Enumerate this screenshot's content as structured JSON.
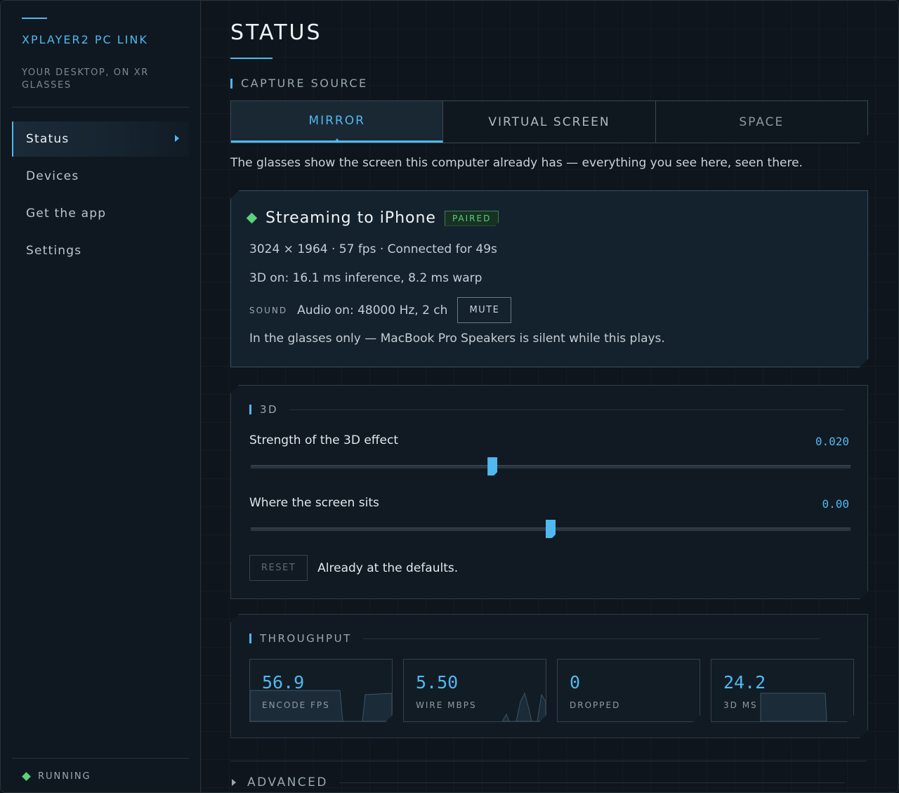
{
  "sidebar": {
    "title": "XPLAYER2 PC LINK",
    "subtitle": "YOUR DESKTOP, ON XR GLASSES",
    "items": [
      {
        "label": "Status"
      },
      {
        "label": "Devices"
      },
      {
        "label": "Get the app"
      },
      {
        "label": "Settings"
      }
    ],
    "status": "RUNNING"
  },
  "main": {
    "title": "STATUS",
    "capture": {
      "label": "CAPTURE SOURCE",
      "tabs": [
        "MIRROR",
        "VIRTUAL SCREEN",
        "SPACE"
      ],
      "selected": "MIRROR",
      "description": "The glasses show the screen this computer already has — everything you see here, seen there."
    },
    "stream": {
      "title": "Streaming to iPhone",
      "badge": "PAIRED",
      "info": "3024 × 1964 · 57 fps · Connected for 49s",
      "timing": "3D on: 16.1 ms inference, 8.2 ms warp",
      "sound_label": "SOUND",
      "sound_text": "Audio on: 48000 Hz, 2 ch",
      "mute_label": "MUTE",
      "note": "In the glasses only — MacBook Pro Speakers is silent while this plays."
    },
    "threed": {
      "label": "3D",
      "strength_label": "Strength of the 3D effect",
      "strength_value": "0.020",
      "strength_fraction": 0.403,
      "position_label": "Where the screen sits",
      "position_value": "0.00",
      "position_fraction": 0.5,
      "reset_label": "RESET",
      "reset_text": "Already at the defaults."
    },
    "throughput": {
      "label": "THROUGHPUT",
      "stats": [
        {
          "value": "56.9",
          "label": "ENCODE FPS"
        },
        {
          "value": "5.50",
          "label": "WIRE MBPS"
        },
        {
          "value": "0",
          "label": "DROPPED"
        },
        {
          "value": "24.2",
          "label": "3D MS"
        }
      ]
    },
    "advanced_label": "ADVANCED"
  },
  "colors": {
    "accent": "#4fb8f0",
    "ok": "#5ad17a",
    "background": "#0e151c"
  }
}
